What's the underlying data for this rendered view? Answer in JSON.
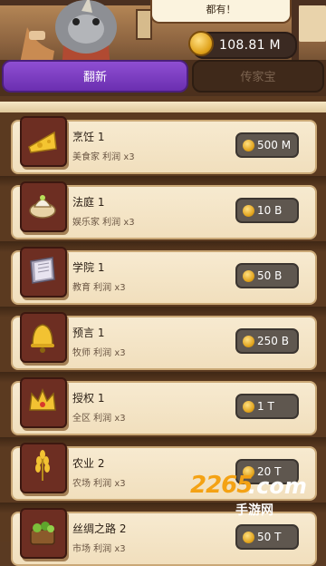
{
  "header": {
    "speech_text": "都有！",
    "currency_amount": "108.81 M"
  },
  "tabs": [
    {
      "label": "翻新",
      "active": true
    },
    {
      "label": "传家宝",
      "active": false
    }
  ],
  "items": [
    {
      "title": "烹饪 1",
      "subtitle": "美食家  利润 x3",
      "cost": "500 M",
      "icon": "cheese-icon"
    },
    {
      "title": "法庭 1",
      "subtitle": "娱乐家  利润 x3",
      "cost": "10 B",
      "icon": "pie-icon"
    },
    {
      "title": "学院 1",
      "subtitle": "教育  利润 x3",
      "cost": "50 B",
      "icon": "book-icon"
    },
    {
      "title": "预言 1",
      "subtitle": "牧师  利润 x3",
      "cost": "250 B",
      "icon": "bell-icon"
    },
    {
      "title": "授权 1",
      "subtitle": "全区  利润 x3",
      "cost": "1 T",
      "icon": "crown-icon"
    },
    {
      "title": "农业 2",
      "subtitle": "农场  利润 x3",
      "cost": "20 T",
      "icon": "wheat-icon"
    },
    {
      "title": "丝绸之路 2",
      "subtitle": "市场  利润 x3",
      "cost": "50 T",
      "icon": "vegetables-icon"
    }
  ],
  "watermark": {
    "brand": "2265",
    "domain": ".com",
    "name": "手游网"
  },
  "colors": {
    "active_tab": "#7a3bc2",
    "cost_button": "#5f574f",
    "card": "#f4e4c6",
    "coin": "#e0a21b"
  }
}
